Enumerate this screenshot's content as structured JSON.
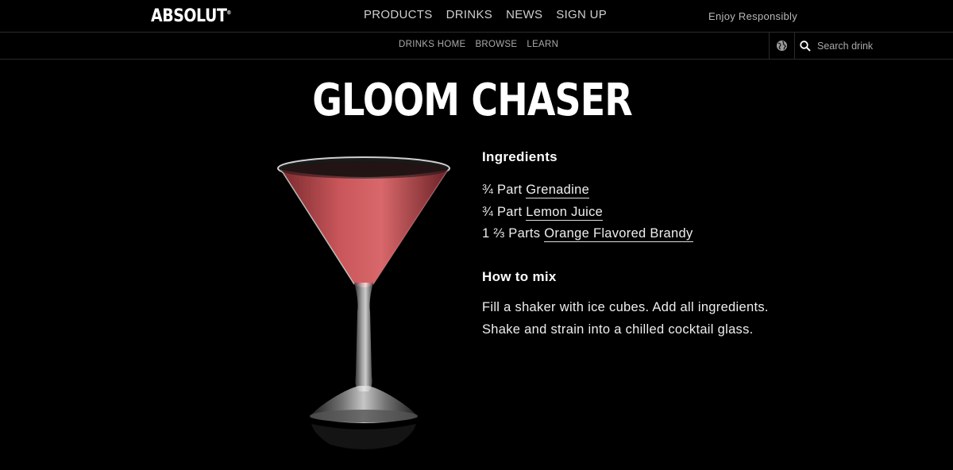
{
  "header": {
    "logo": "ABSOLUT",
    "logo_mark": "®",
    "nav": [
      "PRODUCTS",
      "DRINKS",
      "NEWS",
      "SIGN UP"
    ],
    "tagline": "Enjoy Responsibly"
  },
  "subheader": {
    "nav": [
      "DRINKS HOME",
      "BROWSE",
      "LEARN"
    ],
    "globe_icon": "globe-icon",
    "search_icon": "search-icon",
    "search_placeholder": "Search drink"
  },
  "drink": {
    "title": "GLOOM CHASER",
    "image_icon": "cocktail-glass",
    "liquid_color": "#c9565a",
    "ingredients_heading": "Ingredients",
    "ingredients": [
      {
        "amount": "¾ Part",
        "name": "Grenadine"
      },
      {
        "amount": "¾ Part",
        "name": "Lemon Juice"
      },
      {
        "amount": "1 ⅔ Parts",
        "name": "Orange Flavored Brandy"
      }
    ],
    "howto_heading": "How to mix",
    "instructions": "Fill a shaker with ice cubes. Add all ingredients. Shake and strain into a chilled cocktail glass."
  }
}
